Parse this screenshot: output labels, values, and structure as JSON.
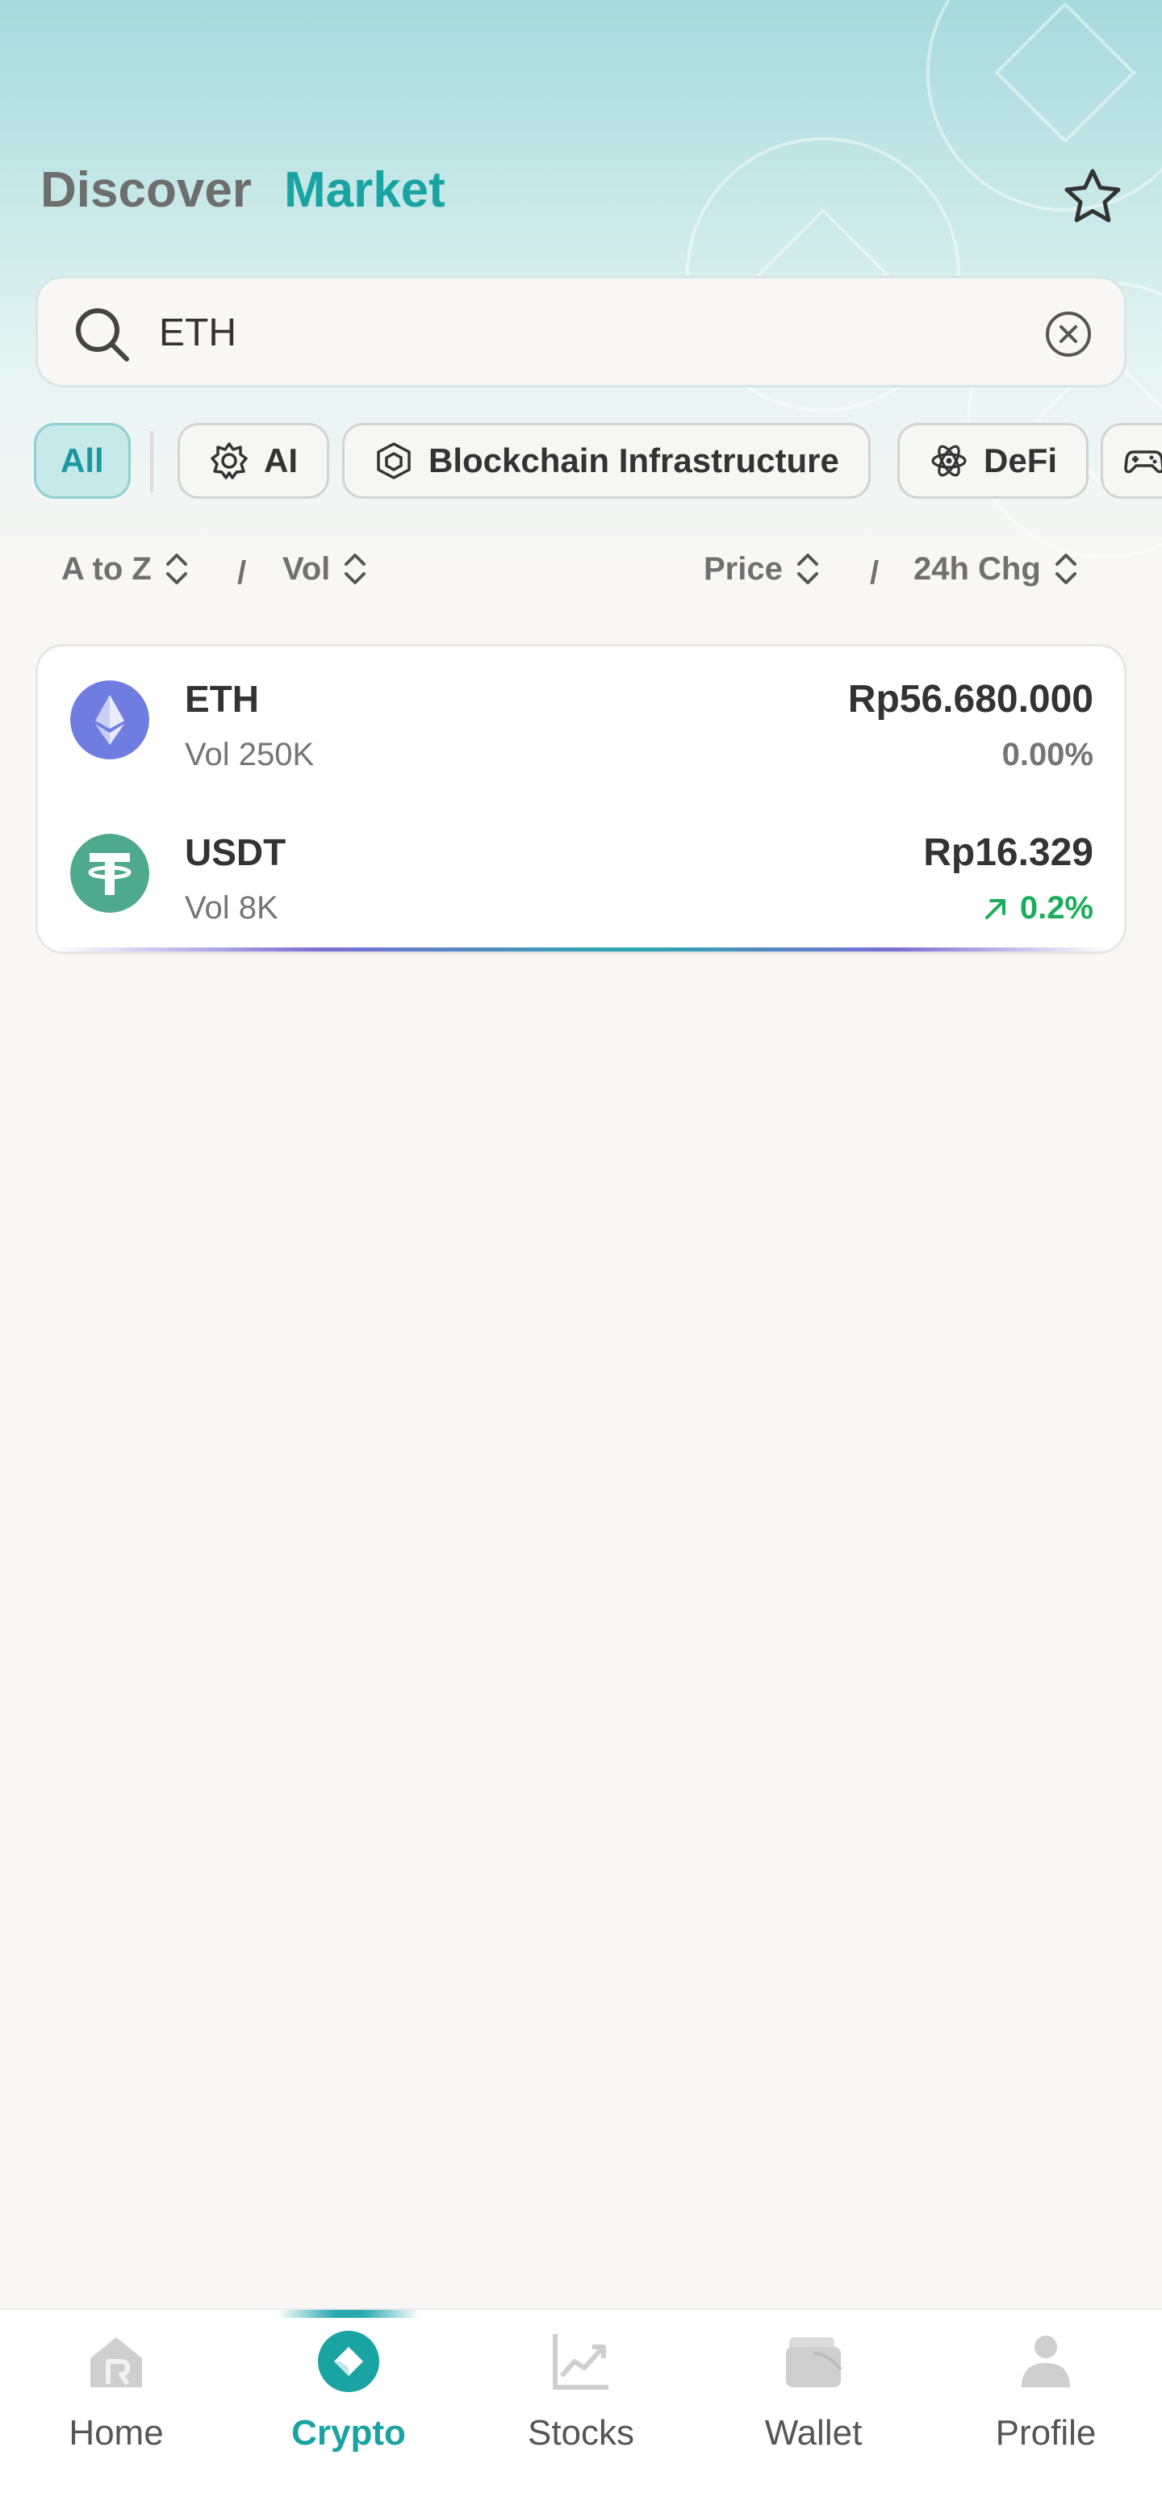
{
  "header": {
    "tabs": [
      {
        "label": "Discover",
        "active": false
      },
      {
        "label": "Market",
        "active": true
      }
    ],
    "favorite_icon": "star-icon"
  },
  "search": {
    "value": "ETH",
    "search_icon": "search-icon",
    "clear_icon": "clear-circle-icon"
  },
  "categories": [
    {
      "label": "All",
      "active": true,
      "icon": ""
    },
    {
      "label": "AI",
      "active": false,
      "icon": "ai-chip-icon"
    },
    {
      "label": "Blockchain Infrastructure",
      "active": false,
      "icon": "cube-icon"
    },
    {
      "label": "DeFi",
      "active": false,
      "icon": "atom-icon"
    },
    {
      "label": "",
      "active": false,
      "icon": "gamepad-icon"
    }
  ],
  "sort": {
    "name_label": "A to Z",
    "vol_label": "Vol",
    "price_label": "Price",
    "change_label": "24h Chg",
    "separator": "/"
  },
  "coins": [
    {
      "symbol": "ETH",
      "volume": "Vol 250K",
      "price": "Rp56.680.000",
      "change": "0.00%",
      "direction": "flat",
      "logo_color": "#6f7de0"
    },
    {
      "symbol": "USDT",
      "volume": "Vol 8K",
      "price": "Rp16.329",
      "change": "0.2%",
      "direction": "up",
      "logo_color": "#4fa98d"
    }
  ],
  "colors": {
    "accent": "#1aa3a3",
    "positive": "#1aae5a",
    "muted": "#757575"
  },
  "nav": [
    {
      "label": "Home",
      "icon": "home-icon",
      "active": false
    },
    {
      "label": "Crypto",
      "icon": "crypto-icon",
      "active": true
    },
    {
      "label": "Stocks",
      "icon": "stocks-chart-icon",
      "active": false
    },
    {
      "label": "Wallet",
      "icon": "wallet-icon",
      "active": false
    },
    {
      "label": "Profile",
      "icon": "profile-icon",
      "active": false
    }
  ]
}
